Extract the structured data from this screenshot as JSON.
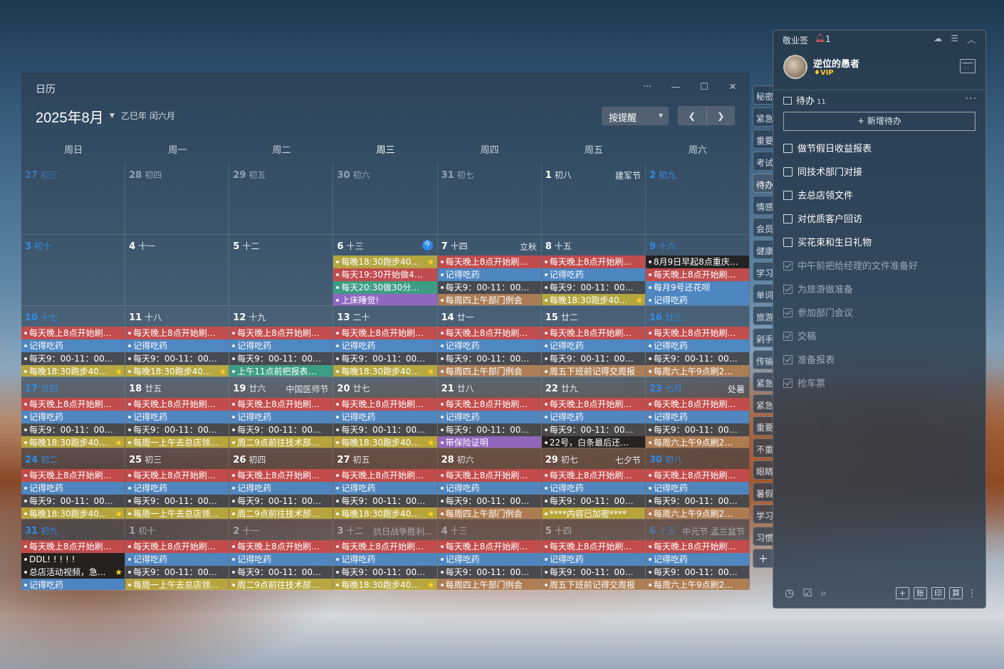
{
  "calendar": {
    "window_title": "日历",
    "month_title": "2025年8月",
    "lunar_year": "乙巳年 闰六月",
    "remind_filter": "按提醒",
    "weekdays": [
      "周日",
      "周一",
      "周二",
      "周三",
      "周四",
      "周五",
      "周六"
    ],
    "today_badge": "今",
    "days": [
      {
        "d": "27",
        "l": "初三",
        "f": "",
        "other": true,
        "w": true,
        "ev": []
      },
      {
        "d": "28",
        "l": "初四",
        "f": "",
        "other": true,
        "ev": []
      },
      {
        "d": "29",
        "l": "初五",
        "f": "",
        "other": true,
        "ev": []
      },
      {
        "d": "30",
        "l": "初六",
        "f": "",
        "other": true,
        "ev": []
      },
      {
        "d": "31",
        "l": "初七",
        "f": "",
        "other": true,
        "ev": []
      },
      {
        "d": "1",
        "l": "初八",
        "f": "建军节",
        "ev": []
      },
      {
        "d": "2",
        "l": "初九",
        "f": "",
        "w": true,
        "ev": []
      },
      {
        "d": "3",
        "l": "初十",
        "f": "",
        "w": true,
        "ev": []
      },
      {
        "d": "4",
        "l": "十一",
        "f": "",
        "ev": []
      },
      {
        "d": "5",
        "l": "十二",
        "f": "",
        "ev": []
      },
      {
        "d": "6",
        "l": "十三",
        "f": "",
        "today": true,
        "ev": [
          {
            "t": "每晚18:30跑步40...",
            "c": "yellow",
            "s": true
          },
          {
            "t": "每天19:30开始做45...",
            "c": "red"
          },
          {
            "t": "每天20:30做30分钟...",
            "c": "green"
          },
          {
            "t": "上床睡觉!",
            "c": "purple"
          }
        ]
      },
      {
        "d": "7",
        "l": "十四",
        "f": "立秋",
        "ev": [
          {
            "t": "每天晚上8点开始刷2...",
            "c": "red"
          },
          {
            "t": "记得吃药",
            "c": "blue"
          },
          {
            "t": "每天9：00-11：00写...",
            "c": "gray"
          },
          {
            "t": "每周四上午部门例会",
            "c": "brown"
          }
        ]
      },
      {
        "d": "8",
        "l": "十五",
        "f": "",
        "ev": [
          {
            "t": "每天晚上8点开始刷2...",
            "c": "red"
          },
          {
            "t": "记得吃药",
            "c": "blue"
          },
          {
            "t": "每天9：00-11：00写...",
            "c": "gray"
          },
          {
            "t": "每晚18:30跑步40...",
            "c": "yellow",
            "s": true
          }
        ]
      },
      {
        "d": "9",
        "l": "十六",
        "f": "",
        "w": true,
        "ev": [
          {
            "t": "8月9日早起8点重庆江...",
            "c": "dark"
          },
          {
            "t": "每天晚上8点开始刷2...",
            "c": "red"
          },
          {
            "t": "每月9号还花呗",
            "c": "blue"
          },
          {
            "t": "记得吃药",
            "c": "blue"
          }
        ]
      },
      {
        "d": "10",
        "l": "十七",
        "f": "",
        "w": true,
        "ev": [
          {
            "t": "每天晚上8点开始刷2...",
            "c": "red"
          },
          {
            "t": "记得吃药",
            "c": "blue"
          },
          {
            "t": "每天9：00-11：00写...",
            "c": "gray"
          },
          {
            "t": "每晚18:30跑步40...",
            "c": "yellow",
            "s": true
          }
        ]
      },
      {
        "d": "11",
        "l": "十八",
        "f": "",
        "ev": [
          {
            "t": "每天晚上8点开始刷2...",
            "c": "red"
          },
          {
            "t": "记得吃药",
            "c": "blue"
          },
          {
            "t": "每天9：00-11：00写...",
            "c": "gray"
          },
          {
            "t": "每晚18:30跑步40...",
            "c": "yellow",
            "s": true
          }
        ]
      },
      {
        "d": "12",
        "l": "十九",
        "f": "",
        "ev": [
          {
            "t": "每天晚上8点开始刷2...",
            "c": "red"
          },
          {
            "t": "记得吃药",
            "c": "blue"
          },
          {
            "t": "每天9：00-11：00写...",
            "c": "gray"
          },
          {
            "t": "上午11点前把报表交...",
            "c": "green"
          }
        ]
      },
      {
        "d": "13",
        "l": "二十",
        "f": "",
        "ev": [
          {
            "t": "每天晚上8点开始刷2...",
            "c": "red"
          },
          {
            "t": "记得吃药",
            "c": "blue"
          },
          {
            "t": "每天9：00-11：00写...",
            "c": "gray"
          },
          {
            "t": "每晚18:30跑步40...",
            "c": "yellow",
            "s": true
          }
        ]
      },
      {
        "d": "14",
        "l": "廿一",
        "f": "",
        "ev": [
          {
            "t": "每天晚上8点开始刷2...",
            "c": "red"
          },
          {
            "t": "记得吃药",
            "c": "blue"
          },
          {
            "t": "每天9：00-11：00写...",
            "c": "gray"
          },
          {
            "t": "每周四上午部门例会",
            "c": "brown"
          }
        ]
      },
      {
        "d": "15",
        "l": "廿二",
        "f": "",
        "ev": [
          {
            "t": "每天晚上8点开始刷2...",
            "c": "red"
          },
          {
            "t": "记得吃药",
            "c": "blue"
          },
          {
            "t": "每天9：00-11：00写...",
            "c": "gray"
          },
          {
            "t": "周五下班前记得交周报",
            "c": "brown"
          }
        ]
      },
      {
        "d": "16",
        "l": "廿三",
        "f": "",
        "w": true,
        "ev": [
          {
            "t": "每天晚上8点开始刷2...",
            "c": "red"
          },
          {
            "t": "记得吃药",
            "c": "blue"
          },
          {
            "t": "每天9：00-11：00写...",
            "c": "gray"
          },
          {
            "t": "每周六上午9点刷2小...",
            "c": "brown"
          }
        ]
      },
      {
        "d": "17",
        "l": "廿四",
        "f": "",
        "w": true,
        "ev": [
          {
            "t": "每天晚上8点开始刷2...",
            "c": "red"
          },
          {
            "t": "记得吃药",
            "c": "blue"
          },
          {
            "t": "每天9：00-11：00写...",
            "c": "gray"
          },
          {
            "t": "每晚18:30跑步40...",
            "c": "yellow",
            "s": true
          }
        ]
      },
      {
        "d": "18",
        "l": "廿五",
        "f": "",
        "ev": [
          {
            "t": "每天晚上8点开始刷2...",
            "c": "red"
          },
          {
            "t": "记得吃药",
            "c": "blue"
          },
          {
            "t": "每天9：00-11：00写...",
            "c": "gray"
          },
          {
            "t": "每周一上午去总店领...",
            "c": "yellow"
          }
        ]
      },
      {
        "d": "19",
        "l": "廿六",
        "f": "中国医师节",
        "ev": [
          {
            "t": "每天晚上8点开始刷2...",
            "c": "red"
          },
          {
            "t": "记得吃药",
            "c": "blue"
          },
          {
            "t": "每天9：00-11：00写...",
            "c": "gray"
          },
          {
            "t": "周二9点前往技术部门...",
            "c": "yellow"
          }
        ]
      },
      {
        "d": "20",
        "l": "廿七",
        "f": "",
        "ev": [
          {
            "t": "每天晚上8点开始刷2...",
            "c": "red"
          },
          {
            "t": "记得吃药",
            "c": "blue"
          },
          {
            "t": "每天9：00-11：00写...",
            "c": "gray"
          },
          {
            "t": "每晚18:30跑步40...",
            "c": "yellow",
            "s": true
          }
        ]
      },
      {
        "d": "21",
        "l": "廿八",
        "f": "",
        "ev": [
          {
            "t": "每天晚上8点开始刷2...",
            "c": "red"
          },
          {
            "t": "记得吃药",
            "c": "blue"
          },
          {
            "t": "每天9：00-11：00写...",
            "c": "gray"
          },
          {
            "t": "带保险证明",
            "c": "purple"
          }
        ]
      },
      {
        "d": "22",
        "l": "廿九",
        "f": "",
        "ev": [
          {
            "t": "每天晚上8点开始刷2...",
            "c": "red"
          },
          {
            "t": "记得吃药",
            "c": "blue"
          },
          {
            "t": "每天9：00-11：00写...",
            "c": "gray"
          },
          {
            "t": "22号，白条最后还款...",
            "c": "dark"
          }
        ]
      },
      {
        "d": "23",
        "l": "七月",
        "f": "处暑",
        "w": true,
        "ev": [
          {
            "t": "每天晚上8点开始刷2...",
            "c": "red"
          },
          {
            "t": "记得吃药",
            "c": "blue"
          },
          {
            "t": "每天9：00-11：00写...",
            "c": "gray"
          },
          {
            "t": "每周六上午9点刷2小...",
            "c": "brown"
          }
        ]
      },
      {
        "d": "24",
        "l": "初二",
        "f": "",
        "w": true,
        "ev": [
          {
            "t": "每天晚上8点开始刷2...",
            "c": "red"
          },
          {
            "t": "记得吃药",
            "c": "blue"
          },
          {
            "t": "每天9：00-11：00写...",
            "c": "gray"
          },
          {
            "t": "每晚18:30跑步40...",
            "c": "yellow",
            "s": true
          }
        ]
      },
      {
        "d": "25",
        "l": "初三",
        "f": "",
        "ev": [
          {
            "t": "每天晚上8点开始刷2...",
            "c": "red"
          },
          {
            "t": "记得吃药",
            "c": "blue"
          },
          {
            "t": "每天9：00-11：00写...",
            "c": "gray"
          },
          {
            "t": "每周一上午去总店领...",
            "c": "yellow"
          }
        ]
      },
      {
        "d": "26",
        "l": "初四",
        "f": "",
        "ev": [
          {
            "t": "每天晚上8点开始刷2...",
            "c": "red"
          },
          {
            "t": "记得吃药",
            "c": "blue"
          },
          {
            "t": "每天9：00-11：00写...",
            "c": "gray"
          },
          {
            "t": "周二9点前往技术部门...",
            "c": "yellow"
          }
        ]
      },
      {
        "d": "27",
        "l": "初五",
        "f": "",
        "ev": [
          {
            "t": "每天晚上8点开始刷2...",
            "c": "red"
          },
          {
            "t": "记得吃药",
            "c": "blue"
          },
          {
            "t": "每天9：00-11：00写...",
            "c": "gray"
          },
          {
            "t": "每晚18:30跑步40...",
            "c": "yellow",
            "s": true
          }
        ]
      },
      {
        "d": "28",
        "l": "初六",
        "f": "",
        "ev": [
          {
            "t": "每天晚上8点开始刷2...",
            "c": "red"
          },
          {
            "t": "记得吃药",
            "c": "blue"
          },
          {
            "t": "每天9：00-11：00写...",
            "c": "gray"
          },
          {
            "t": "每周四上午部门例会",
            "c": "brown"
          }
        ]
      },
      {
        "d": "29",
        "l": "初七",
        "f": "七夕节",
        "ev": [
          {
            "t": "每天晚上8点开始刷2...",
            "c": "red"
          },
          {
            "t": "记得吃药",
            "c": "blue"
          },
          {
            "t": "每天9：00-11：00写...",
            "c": "gray"
          },
          {
            "t": "****内容已加密****",
            "c": "yellow"
          }
        ]
      },
      {
        "d": "30",
        "l": "初八",
        "f": "",
        "w": true,
        "ev": [
          {
            "t": "每天晚上8点开始刷2...",
            "c": "red"
          },
          {
            "t": "记得吃药",
            "c": "blue"
          },
          {
            "t": "每天9：00-11：00写...",
            "c": "gray"
          },
          {
            "t": "每周六上午9点刷2小...",
            "c": "brown"
          }
        ]
      },
      {
        "d": "31",
        "l": "初九",
        "f": "",
        "w": true,
        "ev": [
          {
            "t": "每天晚上8点开始刷2...",
            "c": "red"
          },
          {
            "t": "DDL! ! ! ! !",
            "c": "dark"
          },
          {
            "t": "总店活动视频，急...",
            "c": "dark",
            "s": true
          },
          {
            "t": "记得吃药",
            "c": "blue"
          }
        ]
      },
      {
        "d": "1",
        "l": "初十",
        "f": "",
        "other": true,
        "ev": [
          {
            "t": "每天晚上8点开始刷2...",
            "c": "red"
          },
          {
            "t": "记得吃药",
            "c": "blue"
          },
          {
            "t": "每天9：00-11：00写...",
            "c": "gray"
          },
          {
            "t": "每周一上午去总店领...",
            "c": "yellow"
          }
        ]
      },
      {
        "d": "2",
        "l": "十一",
        "f": "",
        "other": true,
        "ev": [
          {
            "t": "每天晚上8点开始刷2...",
            "c": "red"
          },
          {
            "t": "记得吃药",
            "c": "blue"
          },
          {
            "t": "每天9：00-11：00写...",
            "c": "gray"
          },
          {
            "t": "周二9点前往技术部门...",
            "c": "yellow"
          }
        ]
      },
      {
        "d": "3",
        "l": "十二",
        "f": "抗日战争胜利...",
        "other": true,
        "ev": [
          {
            "t": "每天晚上8点开始刷2...",
            "c": "red"
          },
          {
            "t": "记得吃药",
            "c": "blue"
          },
          {
            "t": "每天9：00-11：00写...",
            "c": "gray"
          },
          {
            "t": "每晚18:30跑步40...",
            "c": "yellow",
            "s": true
          }
        ]
      },
      {
        "d": "4",
        "l": "十三",
        "f": "",
        "other": true,
        "ev": [
          {
            "t": "每天晚上8点开始刷2...",
            "c": "red"
          },
          {
            "t": "记得吃药",
            "c": "blue"
          },
          {
            "t": "每天9：00-11：00写...",
            "c": "gray"
          },
          {
            "t": "每周四上午部门例会",
            "c": "brown"
          }
        ]
      },
      {
        "d": "5",
        "l": "十四",
        "f": "",
        "other": true,
        "ev": [
          {
            "t": "每天晚上8点开始刷2...",
            "c": "red"
          },
          {
            "t": "记得吃药",
            "c": "blue"
          },
          {
            "t": "每天9：00-11：00写...",
            "c": "gray"
          },
          {
            "t": "周五下班前记得交周报",
            "c": "brown"
          }
        ]
      },
      {
        "d": "6",
        "l": "十五",
        "f": "中元节 孟兰盆节",
        "other": true,
        "w": true,
        "ev": [
          {
            "t": "每天晚上8点开始刷2...",
            "c": "red"
          },
          {
            "t": "记得吃药",
            "c": "blue"
          },
          {
            "t": "每天9：00-11：00写...",
            "c": "gray"
          },
          {
            "t": "每周六上午9点刷2小...",
            "c": "brown"
          }
        ]
      }
    ]
  },
  "categories": [
    "秘密",
    "紧急",
    "重要",
    "考试",
    "待办",
    "情感",
    "会员",
    "健康",
    "学习",
    "单词",
    "旅游",
    "剁手",
    "传输",
    "紧急",
    "紧急",
    "重要",
    "不重",
    "眼睛",
    "暑假",
    "学习",
    "习惯"
  ],
  "active_category": "待办",
  "add_category": "+",
  "notes": {
    "app_name": "敬业签",
    "bell_count": "1",
    "user_name": "逆位的愚者",
    "vip_label": "VIP",
    "todo_title": "待办",
    "todo_count": "11",
    "new_todo": "+ 新增待办",
    "todos": [
      {
        "t": "做节假日收益报表",
        "done": false
      },
      {
        "t": "同技术部门对接",
        "done": false
      },
      {
        "t": "去总店领文件",
        "done": false
      },
      {
        "t": "对优质客户回访",
        "done": false
      },
      {
        "t": "买花束和生日礼物",
        "done": false
      },
      {
        "t": "中午前把给经理的文件准备好",
        "done": true
      },
      {
        "t": "为旅游做准备",
        "done": true
      },
      {
        "t": "参加部门会议",
        "done": true
      },
      {
        "t": "交稿",
        "done": true
      },
      {
        "t": "准备报表",
        "done": true
      },
      {
        "t": "抢车票",
        "done": true
      }
    ],
    "bottom_buttons": [
      "账",
      "印",
      "算"
    ]
  },
  "icons": {
    "window": [
      "more-icon",
      "minimize-icon",
      "maximize-icon",
      "close-icon"
    ],
    "nav": [
      "chevron-left-icon",
      "chevron-right-icon"
    ],
    "notes_top": [
      "cloud-sync-icon",
      "menu-icon",
      "collapse-icon"
    ],
    "notes_bottom": [
      "clock-icon",
      "checklist-icon",
      "search-icon"
    ]
  }
}
